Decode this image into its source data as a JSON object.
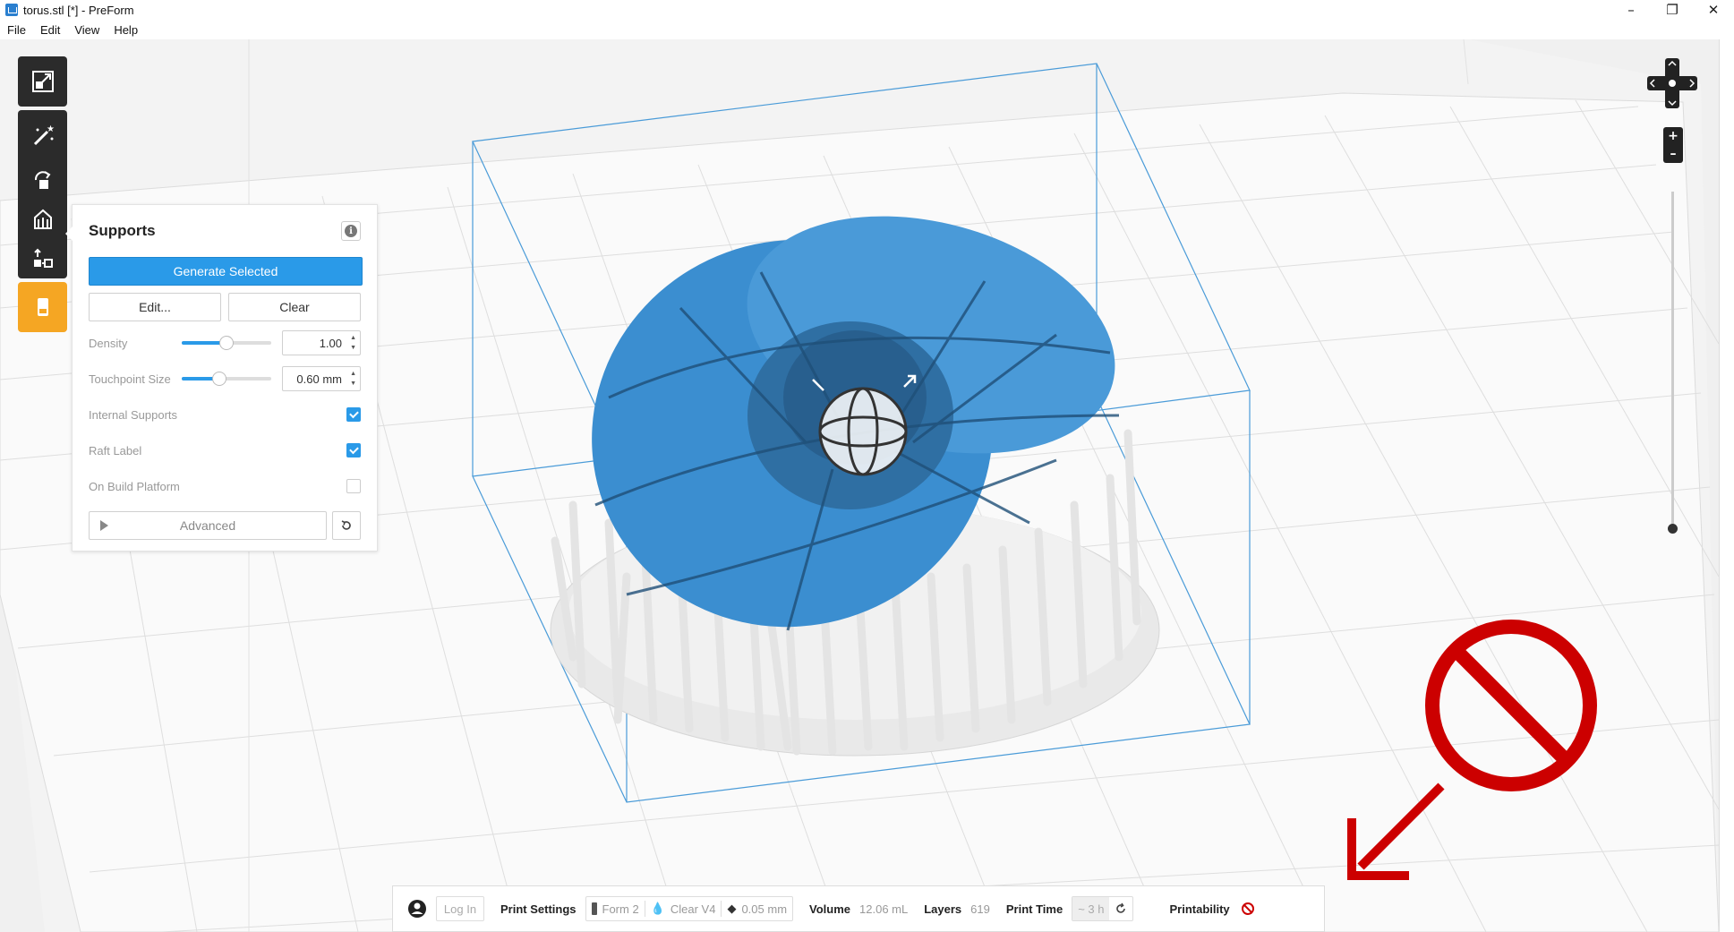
{
  "window": {
    "title": "torus.stl [*] - PreForm",
    "app_icon": "preform-app-icon",
    "controls": [
      "minimize-icon",
      "restore-icon",
      "close-icon"
    ]
  },
  "menu": [
    "File",
    "Edit",
    "View",
    "Help"
  ],
  "toolbar": {
    "tools": [
      "scale-icon",
      "magic-wand-icon",
      "orientation-icon",
      "supports-icon",
      "layout-icon",
      "print-icon"
    ],
    "active_color": "#f5a623"
  },
  "supports_panel": {
    "title": "Supports",
    "info_label": "i",
    "generate_label": "Generate Selected",
    "edit_label": "Edit...",
    "clear_label": "Clear",
    "density": {
      "label": "Density",
      "value": "1.00",
      "slider_fraction": 0.5
    },
    "touchpoint": {
      "label": "Touchpoint Size",
      "value": "0.60 mm",
      "slider_fraction": 0.42
    },
    "internal_supports": {
      "label": "Internal Supports",
      "checked": true
    },
    "raft_label": {
      "label": "Raft Label",
      "checked": true
    },
    "on_build_platform": {
      "label": "On Build Platform",
      "checked": false
    },
    "advanced_label": "Advanced"
  },
  "status_bar": {
    "login_label": "Log In",
    "print_settings_label": "Print Settings",
    "printer": "Form 2",
    "resin": "Clear V4",
    "layer_height": "0.05 mm",
    "volume_label": "Volume",
    "volume_value": "12.06 mL",
    "layers_label": "Layers",
    "layers_value": "619",
    "print_time_label": "Print Time",
    "print_time_value": "~ 3 h",
    "printability_label": "Printability"
  },
  "colors": {
    "accent": "#2a9ae8",
    "model": "#3d8fcf",
    "supports": "#e8e8e8",
    "warning_red": "#cc0000"
  }
}
